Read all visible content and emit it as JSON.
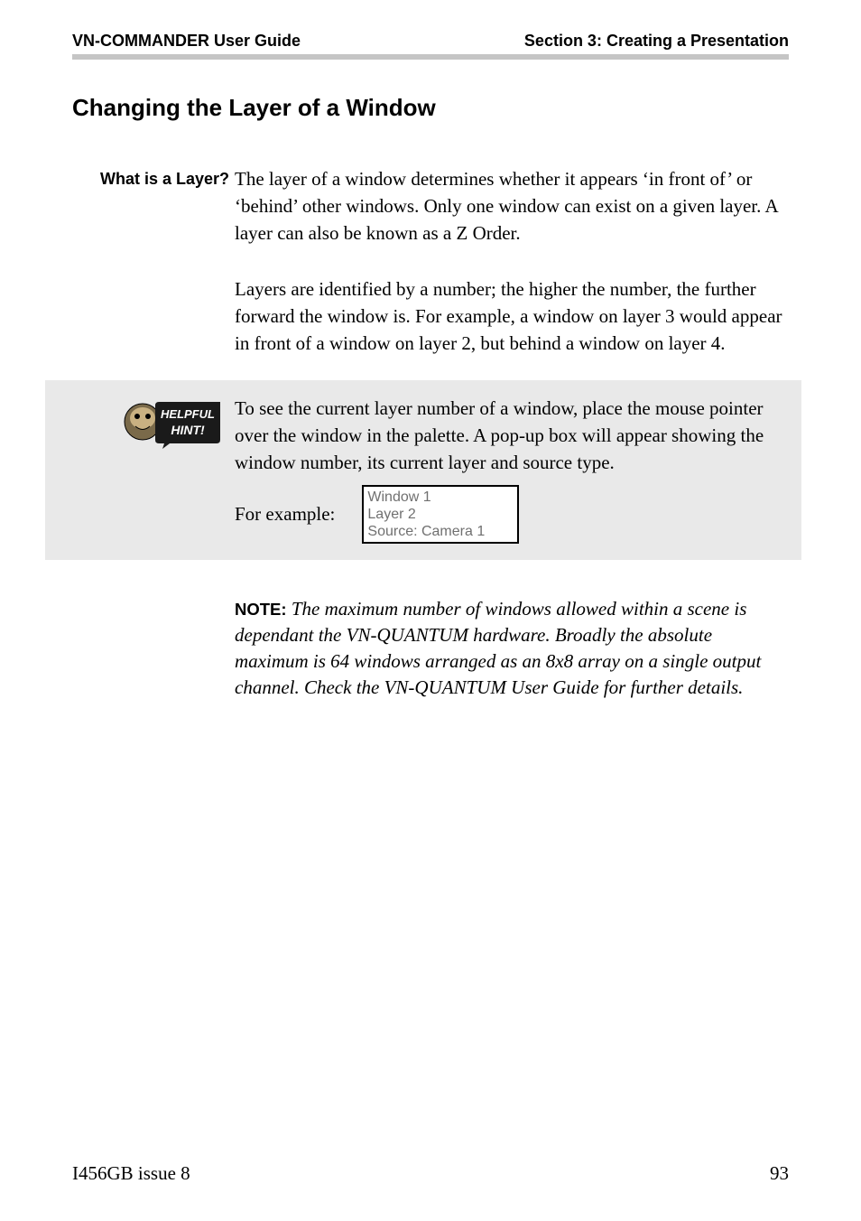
{
  "header": {
    "left": "VN-COMMANDER User Guide",
    "right": "Section 3: Creating a Presentation"
  },
  "title": "Changing the Layer of a Window",
  "sideLabel": "What is a Layer?",
  "para1": "The layer of a window determines whether it appears ‘in front of’ or ‘behind’ other windows. Only one window can exist on a given layer. A layer can also be known as a Z Order.",
  "para2": "Layers are identified by a number; the higher the number, the further forward the window is. For example, a window on layer 3 would appear in front of a window on layer 2, but behind a window on layer 4.",
  "hint": {
    "iconLabelTop": "HELPFUL",
    "iconLabelBottom": "HINT!",
    "text": "To see the current layer number of a window, place the mouse pointer over the window in the palette. A pop-up box will appear showing the window number, its current layer and source type.",
    "exampleLabel": "For example:",
    "tooltip": {
      "line1": "Window 1",
      "line2": "Layer 2",
      "line3": "Source: Camera 1"
    }
  },
  "note": {
    "label": "NOTE:",
    "text": "The maximum number of windows allowed within a scene is dependant the VN-QUANTUM hardware. Broadly the absolute maximum is 64 windows arranged as an 8x8 array on a single output channel. Check the VN-QUANTUM User Guide for further details."
  },
  "footer": {
    "left": "I456GB issue 8",
    "right": "93"
  }
}
